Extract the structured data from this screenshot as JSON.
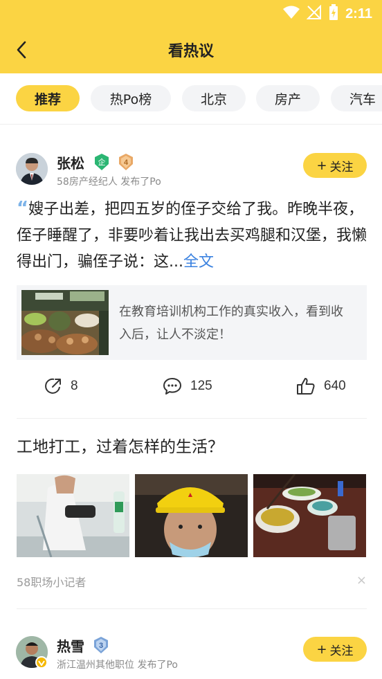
{
  "status_bar": {
    "time": "2:11"
  },
  "header": {
    "title": "看热议"
  },
  "tabs": [
    {
      "label": "推荐",
      "active": true
    },
    {
      "label": "热Po榜"
    },
    {
      "label": "北京"
    },
    {
      "label": "房产"
    },
    {
      "label": "汽车"
    }
  ],
  "post1": {
    "author": "张松",
    "badge_enterprise": "企",
    "level": "4",
    "meta": "58房产经纪人 发布了Po",
    "follow_label": "关注",
    "text": "嫂子出差，把四五岁的侄子交给了我。昨晚半夜，侄子睡醒了，非要吵着让我出去买鸡腿和汉堡，我懒得出门，骗侄子说：这...",
    "more": "全文",
    "link_title": "在教育培训机构工作的真实收入，看到收入后，让人不淡定！",
    "share_count": "8",
    "comment_count": "125",
    "like_count": "640"
  },
  "post2": {
    "question": "工地打工，过着怎样的生活？",
    "source": "58职场小记者",
    "close": "×"
  },
  "post3": {
    "author": "热雪",
    "level": "3",
    "meta": "浙江温州其他职位 发布了Po",
    "follow_label": "关注"
  },
  "colors": {
    "brand_yellow": "#fbd443",
    "link_blue": "#3b82e0"
  }
}
